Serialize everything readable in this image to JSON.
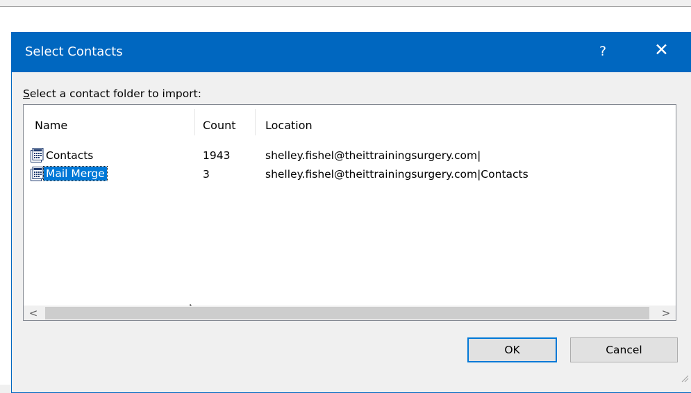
{
  "dialog": {
    "title": "Select Contacts",
    "help_glyph": "?",
    "close_glyph": "✕",
    "prompt_label": "Select a contact folder to import:",
    "accent_color": "#0067c0"
  },
  "list": {
    "columns": [
      "Name",
      "Count",
      "Location"
    ],
    "rows": [
      {
        "name": "Contacts",
        "count": "1943",
        "location": "shelley.fishel@theittrainingsurgery.com|",
        "selected": false
      },
      {
        "name": "Mail Merge",
        "count": "3",
        "location": "shelley.fishel@theittrainingsurgery.com|Contacts",
        "selected": true
      }
    ],
    "row_icon": "contacts-folder-icon",
    "selection_color": "#0078d7"
  },
  "scrollbar": {
    "left_glyph": "<",
    "right_glyph": ">"
  },
  "buttons": {
    "ok_label": "OK",
    "cancel_label": "Cancel"
  }
}
